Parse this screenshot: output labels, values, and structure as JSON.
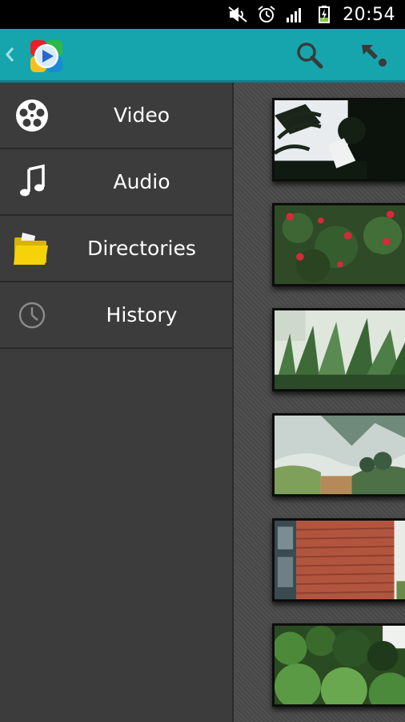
{
  "status_bar": {
    "time": "20:54",
    "icons": [
      "mute-icon",
      "alarm-icon",
      "signal-icon",
      "battery-charging-icon"
    ]
  },
  "app_bar": {
    "back_icon": "chevron-left-icon",
    "logo_icon": "play-logo-icon",
    "actions": [
      "search-icon",
      "collapse-arrow-icon"
    ]
  },
  "drawer": {
    "items": [
      {
        "label": "Video",
        "icon": "film-reel-icon"
      },
      {
        "label": "Audio",
        "icon": "music-note-icon"
      },
      {
        "label": "Directories",
        "icon": "folder-icon"
      },
      {
        "label": "History",
        "icon": "clock-icon"
      }
    ]
  },
  "thumbnails": [
    {
      "subject": "palm-trees"
    },
    {
      "subject": "red-flowers"
    },
    {
      "subject": "plants"
    },
    {
      "subject": "landscape-painting"
    },
    {
      "subject": "brick-wall"
    },
    {
      "subject": "shrubs"
    }
  ],
  "colors": {
    "accent": "#16a5ac",
    "drawer_bg": "#3c3c3c",
    "content_bg": "#4a4a4a"
  }
}
